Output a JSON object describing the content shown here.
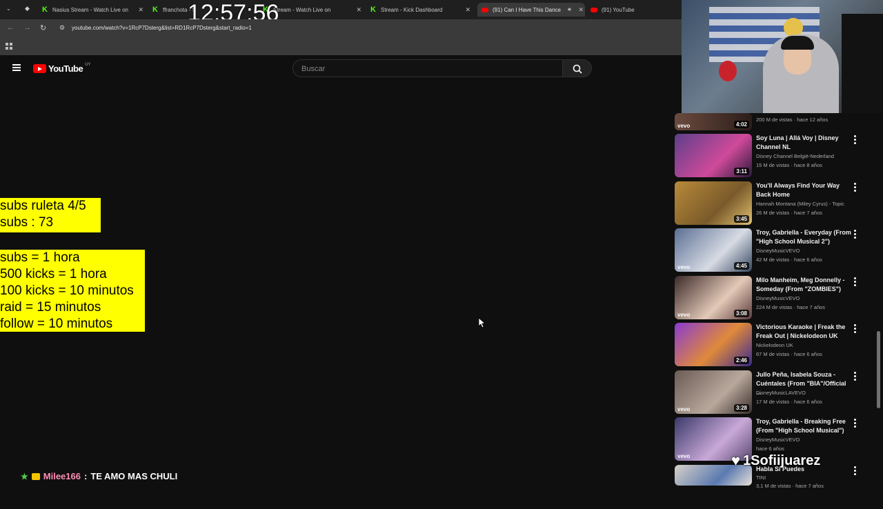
{
  "browser": {
    "tabs": [
      {
        "label": "Nasius Stream - Watch Live on",
        "favicon": "kick-icon"
      },
      {
        "label": "ffranchota - Stream",
        "favicon": "kick-icon"
      },
      {
        "label": "Stream - Watch Live on",
        "favicon": "kick-icon"
      },
      {
        "label": "Stream - Kick Dashboard",
        "favicon": "kick-icon"
      },
      {
        "label": "(91) Can I Have This Dance",
        "favicon": "youtube-icon"
      },
      {
        "label": "(91) YouTube",
        "favicon": "youtube-icon"
      }
    ],
    "url": "youtube.com/watch?v=1RcP7Dsterg&list=RD1RcP7Dsterg&start_radio=1"
  },
  "overlay": {
    "clock": "12:57:56",
    "box1": [
      "subs ruleta 4/5",
      "subs : 73"
    ],
    "box2": [
      "subs = 1 hora",
      "500 kicks = 1 hora",
      "100 kicks = 10 minutos",
      "raid = 15 minutos",
      "follow = 10 minutos"
    ],
    "chat_user": "Milee166",
    "chat_sep": ":",
    "chat_message": "TE AMO MAS CHULI",
    "alert_name": "1Sofiijuarez"
  },
  "youtube": {
    "logo_text": "YouTube",
    "country": "UY",
    "search_placeholder": "Buscar",
    "partial_meta": "200 M de vistas · hace 12 años",
    "partial_duration": "4:02",
    "videos": [
      {
        "title": "Soy Luna | Allá Voy | Disney Channel NL",
        "channel": "Disney Channel België-Nederland",
        "meta": "15 M de vistas · hace 8 años",
        "duration": "3:11"
      },
      {
        "title": "You'll Always Find Your Way Back Home",
        "channel": "Hannah Montana (Miley Cyrus) - Topic",
        "meta": "26 M de vistas · hace 7 años",
        "duration": "3:45"
      },
      {
        "title": "Troy, Gabriella - Everyday (From \"High School Musical 2\")",
        "channel": "DisneyMusicVEVO",
        "meta": "42 M de vistas · hace 6 años",
        "duration": "4:45"
      },
      {
        "title": "Milo Manheim, Meg Donnelly - Someday (From \"ZOMBIES\")",
        "channel": "DisneyMusicVEVO",
        "meta": "224 M de vistas · hace 7 años",
        "duration": "3:08"
      },
      {
        "title": "Victorious Karaoke | Freak the Freak Out | Nickelodeon UK",
        "channel": "Nickelodeon UK",
        "meta": "67 M de vistas · hace 6 años",
        "duration": "2:46"
      },
      {
        "title": "Jullo Peña, Isabela Souza - Cuéntales (From \"BIA\"/Official ...",
        "channel": "DisneyMusicLAVEVO",
        "meta": "17 M de vistas · hace 6 años",
        "duration": "3:28"
      },
      {
        "title": "Troy, Gabriella - Breaking Free (From \"High School Musical\")",
        "channel": "DisneyMusicVEVO",
        "meta": "hace 6 años",
        "duration": ""
      },
      {
        "title": "Habla Si Puedes",
        "channel": "TINI",
        "meta": "3,1 M de vistas · hace 7 años",
        "duration": ""
      }
    ]
  },
  "colors": {
    "accent": "#ff0000",
    "overlay_yellow": "#ffff00",
    "kick_green": "#53fc18"
  }
}
